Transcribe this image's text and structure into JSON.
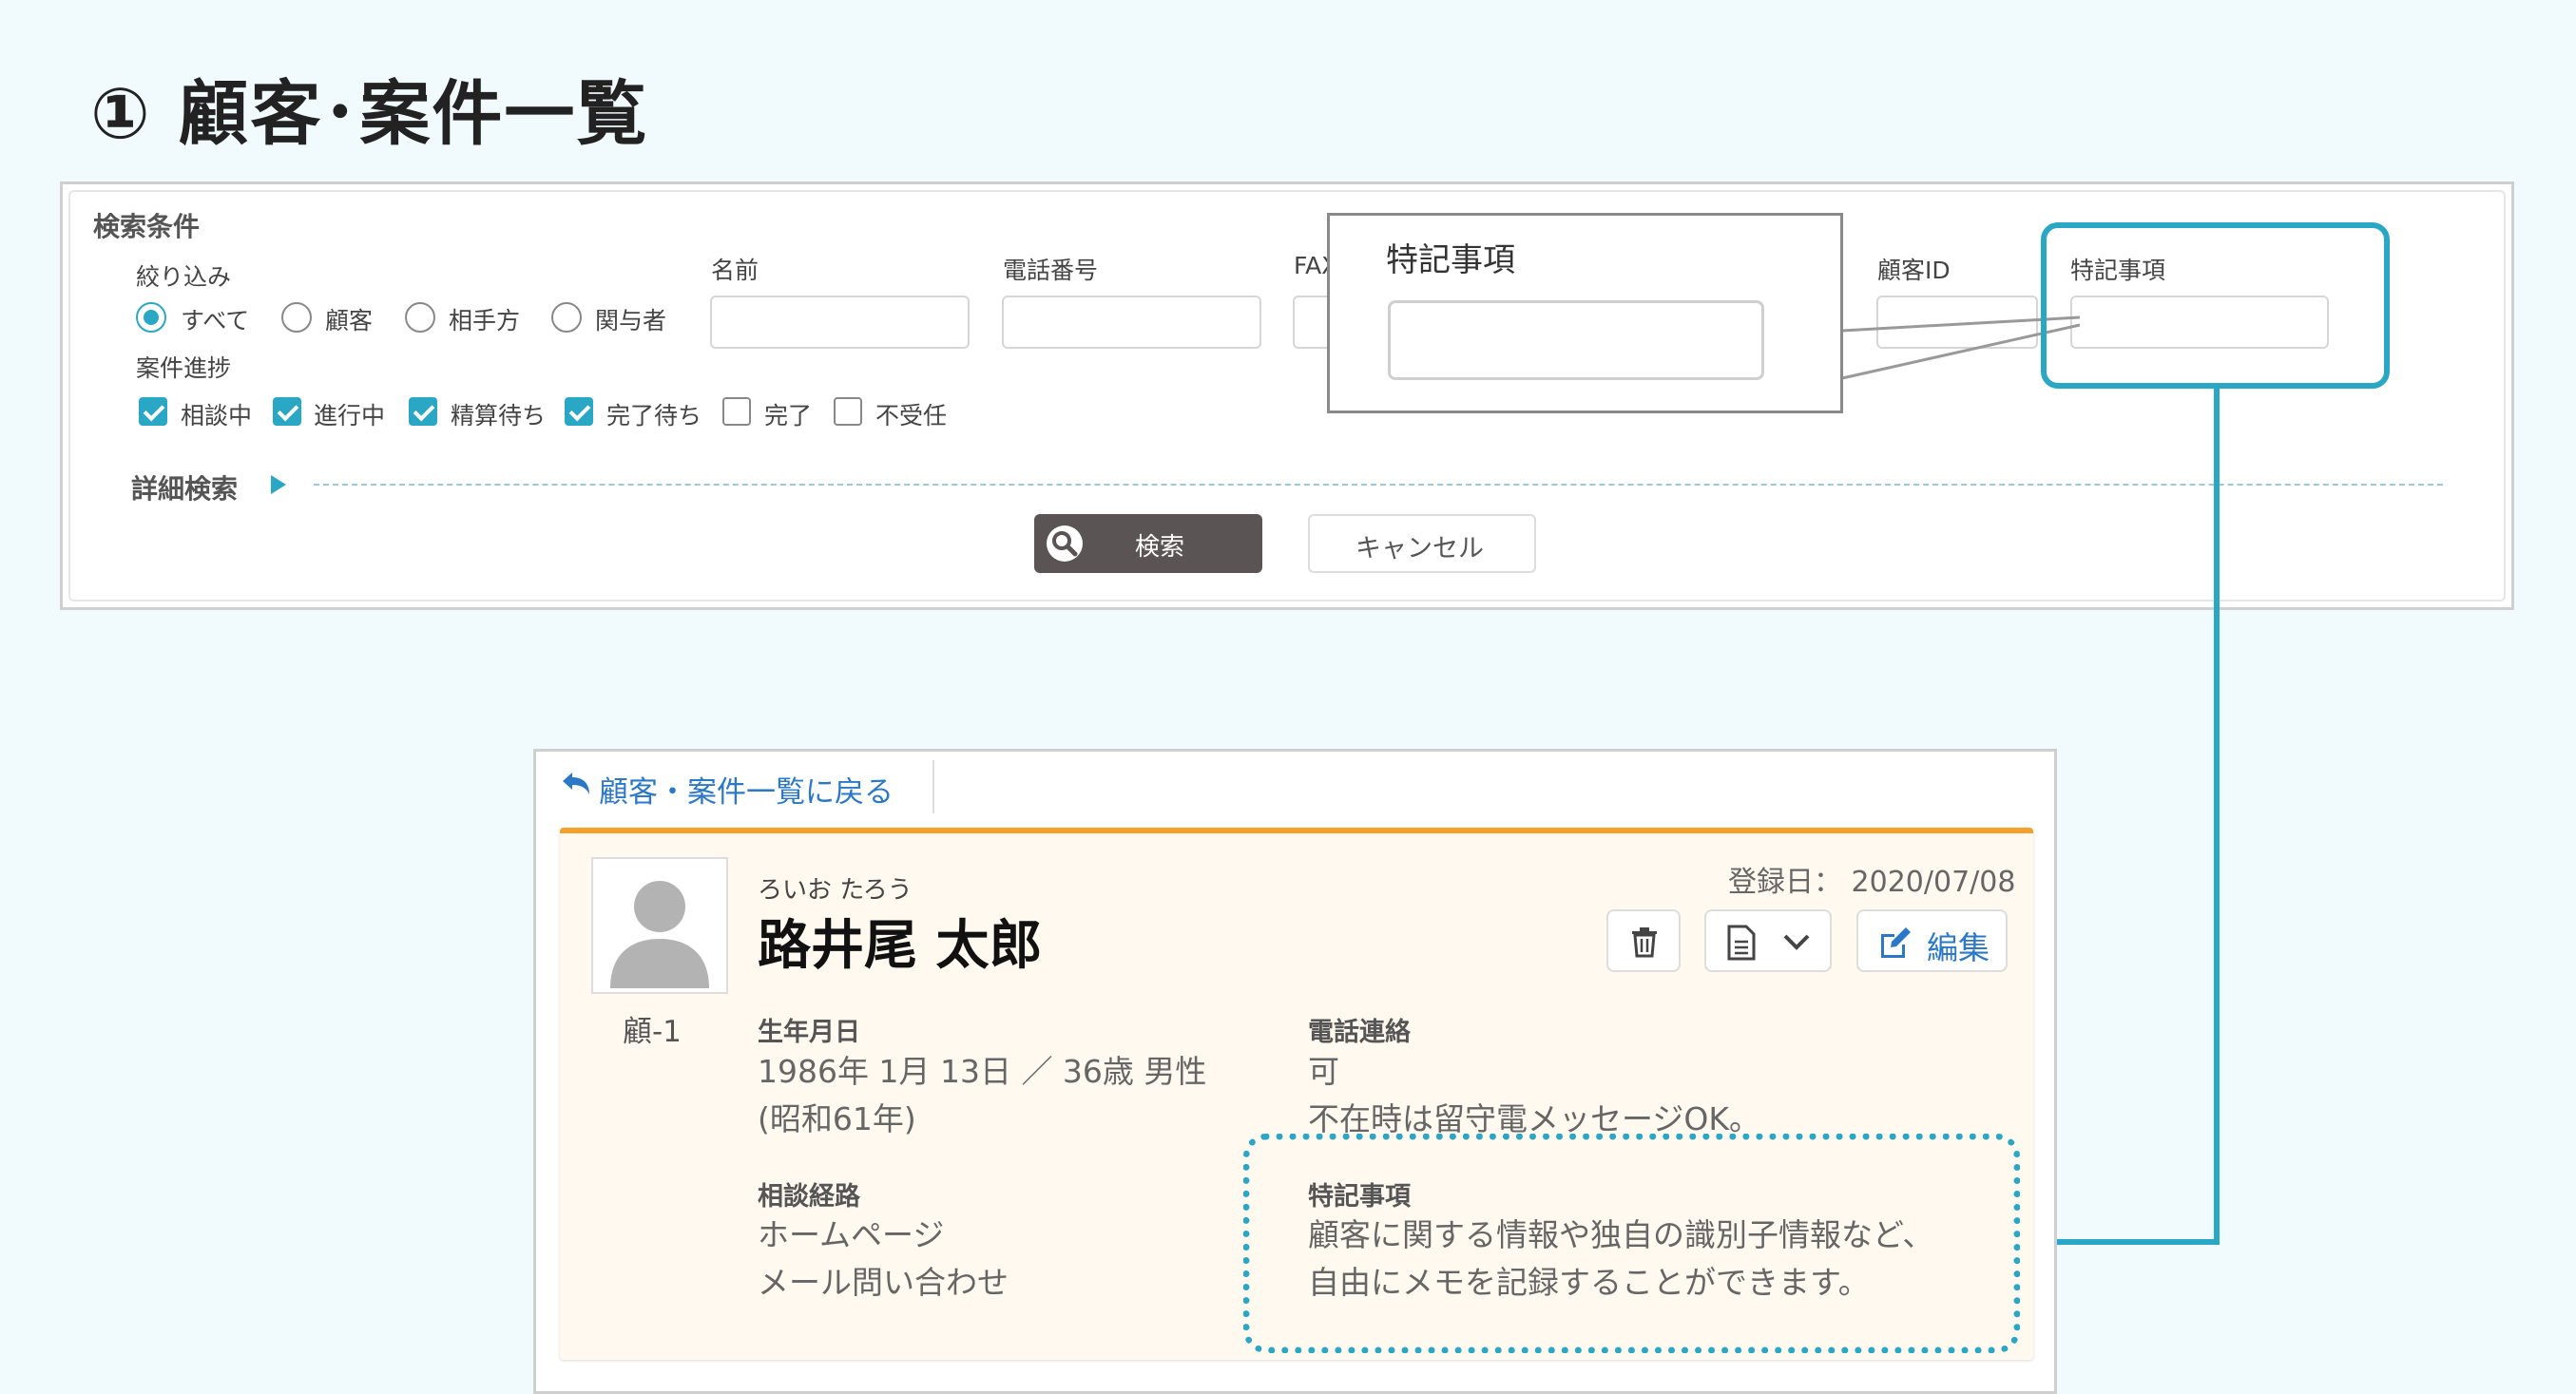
{
  "page": {
    "title": "① 顧客･案件一覧"
  },
  "search": {
    "section_title": "検索条件",
    "filter_label": "絞り込み",
    "filter_options": [
      {
        "label": "すべて",
        "selected": true
      },
      {
        "label": "顧客",
        "selected": false
      },
      {
        "label": "相手方",
        "selected": false
      },
      {
        "label": "関与者",
        "selected": false
      }
    ],
    "progress_label": "案件進捗",
    "progress_options": [
      {
        "label": "相談中",
        "checked": true
      },
      {
        "label": "進行中",
        "checked": true
      },
      {
        "label": "精算待ち",
        "checked": true
      },
      {
        "label": "完了待ち",
        "checked": true
      },
      {
        "label": "完了",
        "checked": false
      },
      {
        "label": "不受任",
        "checked": false
      }
    ],
    "fields": {
      "name": "名前",
      "phone": "電話番号",
      "fax": "FAX",
      "customer_id": "顧客ID",
      "special_notes": "特記事項"
    },
    "advanced_label": "詳細検索",
    "search_button": "検索",
    "cancel_button": "キャンセル"
  },
  "zoom": {
    "label": "特記事項"
  },
  "detail": {
    "back_link": "顧客・案件一覧に戻る",
    "customer_code": "顧-1",
    "furigana": "ろいお たろう",
    "name": "路井尾 太郎",
    "registered": "登録日： 2020/07/08",
    "edit_button": "編集",
    "birth_title": "生年月日",
    "birth_value": "1986年 1月 13日 ／ 36歳 男性",
    "birth_era": "(昭和61年)",
    "phone_title": "電話連絡",
    "phone_value": "可",
    "phone_note": "不在時は留守電メッセージOK。",
    "route_title": "相談経路",
    "route_line1": "ホームページ",
    "route_line2": "メール問い合わせ",
    "notes_title": "特記事項",
    "notes_line1": "顧客に関する情報や独自の識別子情報など、",
    "notes_line2": "自由にメモを記録することができます。"
  },
  "colors": {
    "accent": "#2aa7c4",
    "card_border": "#f3a12a",
    "search_button": "#5b5454",
    "link": "#2b78c8"
  },
  "icons": [
    "search-icon",
    "trash-icon",
    "document-icon",
    "chevron-down-icon",
    "edit-icon",
    "back-arrow-icon",
    "avatar-placeholder-icon",
    "triangle-right-icon"
  ]
}
